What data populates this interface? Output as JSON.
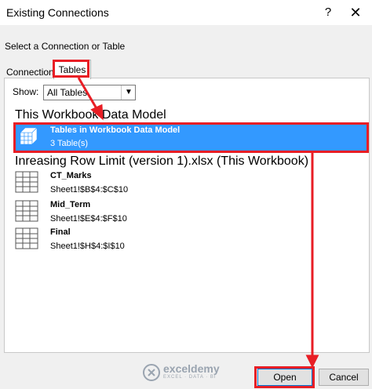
{
  "window": {
    "title": "Existing Connections",
    "help_label": "?",
    "close_label": "✕"
  },
  "dialog": {
    "subtitle": "Select a Connection or Table"
  },
  "tabs": [
    {
      "label": "Connections",
      "selected": false
    },
    {
      "label": "Tables",
      "selected": true
    }
  ],
  "filter": {
    "label": "Show:",
    "value": "All Tables"
  },
  "groups": [
    {
      "title": "This Workbook Data Model",
      "items": [
        {
          "name": "Tables in Workbook Data Model",
          "detail": "3 Table(s)",
          "icon": "data-model-cube-icon",
          "selected": true
        }
      ]
    },
    {
      "title": "Inreasing Row Limit (version 1).xlsx (This Workbook)",
      "items": [
        {
          "name": "CT_Marks",
          "detail": "Sheet1!$B$4:$C$10",
          "icon": "table-icon"
        },
        {
          "name": "Mid_Term",
          "detail": "Sheet1!$E$4:$F$10",
          "icon": "table-icon"
        },
        {
          "name": "Final",
          "detail": "Sheet1!$H$4:$I$10",
          "icon": "table-icon"
        }
      ]
    }
  ],
  "buttons": {
    "open": "Open",
    "cancel": "Cancel"
  },
  "watermark": {
    "name": "exceldemy",
    "tagline": "EXCEL · DATA · BI"
  },
  "colors": {
    "selection": "#3399ff",
    "highlight": "#e81e25",
    "dialog_bg": "#f0f0f0"
  }
}
